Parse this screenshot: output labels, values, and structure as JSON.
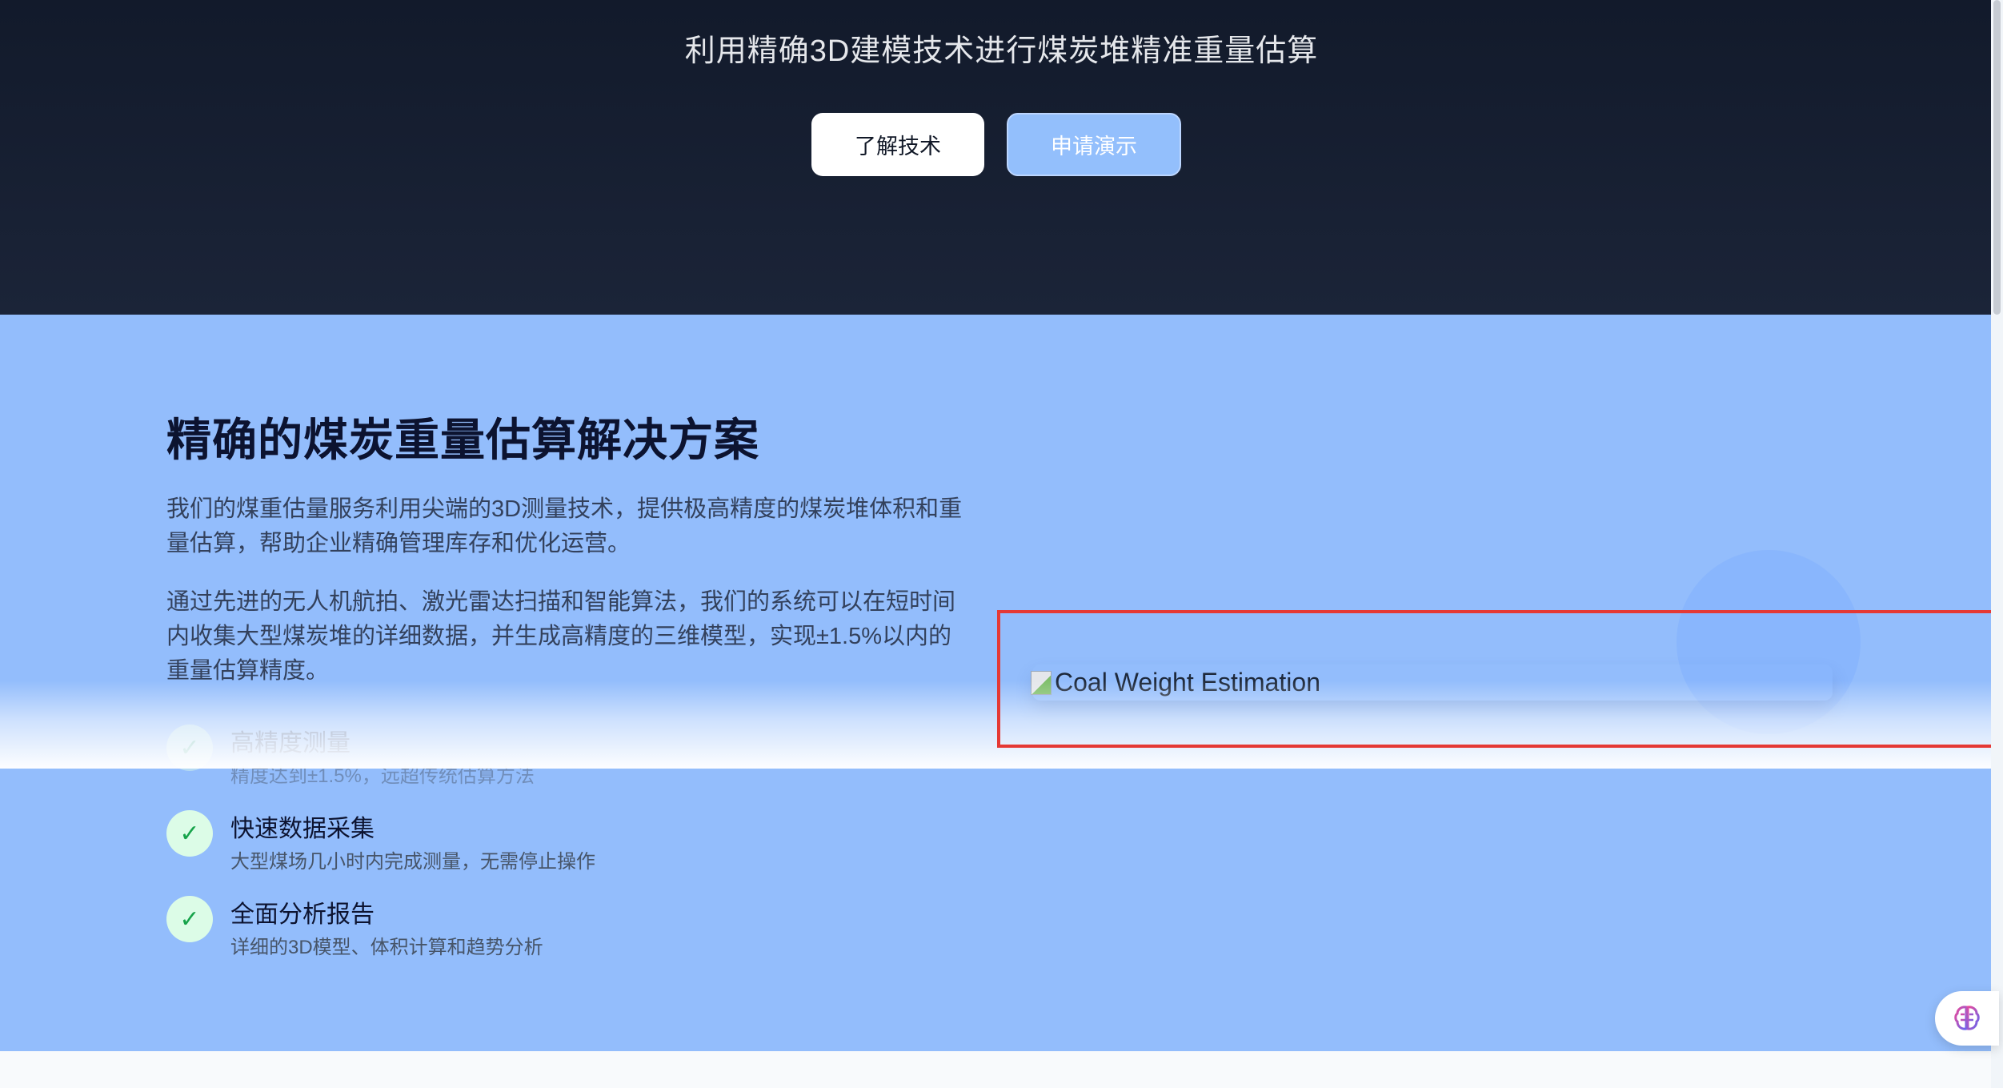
{
  "hero": {
    "subtitle": "利用精确3D建模技术进行煤炭堆精准重量估算",
    "buttons": {
      "learn_label": "了解技术",
      "demo_label": "申请演示"
    }
  },
  "section": {
    "title": "精确的煤炭重量估算解决方案",
    "paragraphs": [
      "我们的煤重估量服务利用尖端的3D测量技术，提供极高精度的煤炭堆体积和重量估算，帮助企业精确管理库存和优化运营。",
      "通过先进的无人机航拍、激光雷达扫描和智能算法，我们的系统可以在短时间内收集大型煤炭堆的详细数据，并生成高精度的三维模型，实现±1.5%以内的重量估算精度。"
    ],
    "features": [
      {
        "title": "高精度测量",
        "desc": "精度达到±1.5%，远超传统估算方法"
      },
      {
        "title": "快速数据采集",
        "desc": "大型煤场几小时内完成测量，无需停止操作"
      },
      {
        "title": "全面分析报告",
        "desc": "详细的3D模型、体积计算和趋势分析"
      }
    ],
    "image_alt": "Coal Weight Estimation"
  },
  "icons": {
    "check": "✓",
    "fab": "brain-icon"
  },
  "colors": {
    "hero_bg": "#121a2b",
    "section_bg": "#93bdfc",
    "check_bg": "#dcfce7",
    "check_fg": "#16a34a",
    "highlight": "#e53935"
  }
}
